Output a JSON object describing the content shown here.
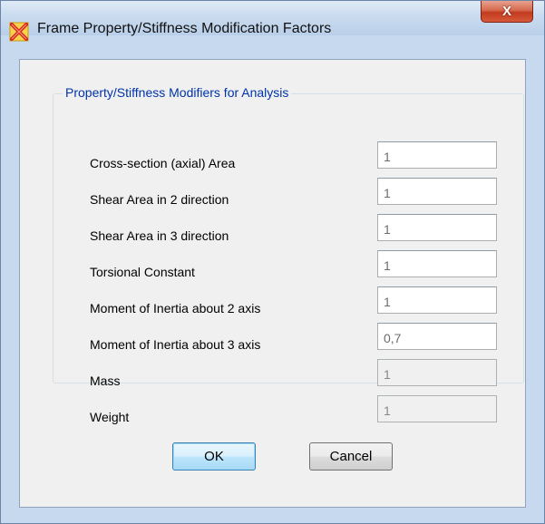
{
  "window": {
    "title": "Frame Property/Stiffness Modification Factors",
    "close_label": "X"
  },
  "group": {
    "title": "Property/Stiffness Modifiers for Analysis",
    "rows": [
      {
        "label": "Cross-section (axial) Area",
        "value": "1",
        "enabled": true
      },
      {
        "label": "Shear Area in 2 direction",
        "value": "1",
        "enabled": true
      },
      {
        "label": "Shear Area in 3 direction",
        "value": "1",
        "enabled": true
      },
      {
        "label": "Torsional Constant",
        "value": "1",
        "enabled": true
      },
      {
        "label": "Moment of Inertia about 2 axis",
        "value": "1",
        "enabled": true
      },
      {
        "label": "Moment of Inertia about 3 axis",
        "value": "0,7",
        "enabled": true
      },
      {
        "label": "Mass",
        "value": "1",
        "enabled": false
      },
      {
        "label": "Weight",
        "value": "1",
        "enabled": false
      }
    ]
  },
  "buttons": {
    "ok": "OK",
    "cancel": "Cancel"
  },
  "colors": {
    "accent": "#0033aa",
    "close": "#c23b1f",
    "frame": "#c6d9ee"
  },
  "icons": {
    "app": "sap2000-frame-icon",
    "close": "close-icon"
  }
}
